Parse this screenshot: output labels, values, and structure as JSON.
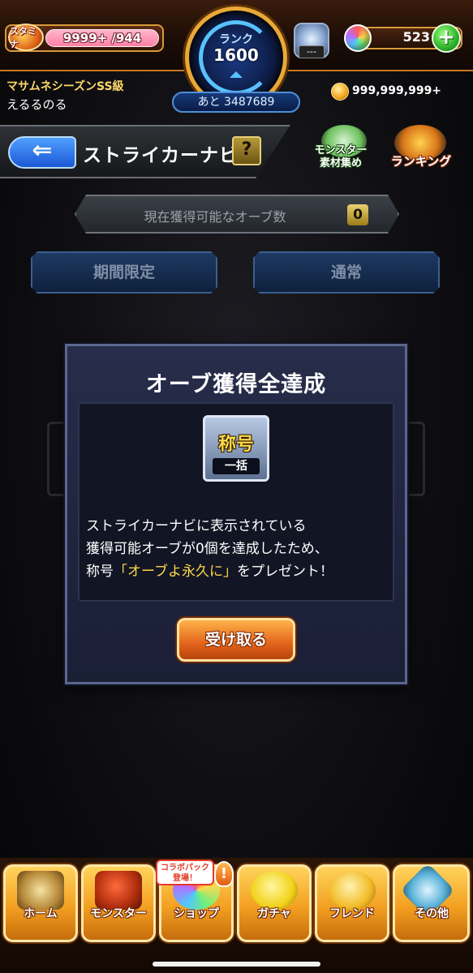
{
  "hud": {
    "stamina_label": "スタミナ",
    "stamina_value": "9999+ /944",
    "rank_label": "ランク",
    "rank_value": "1600",
    "rank_next": "あと 3487689",
    "crystal_placeholder": "---",
    "orb_count": "523",
    "orb_plus": "+",
    "player_title": "マサムネシーズンSS級",
    "player_name": "えるるのる",
    "gold": "999,999,999+"
  },
  "header": {
    "back_icon": "⇐",
    "title": "ストライカーナビ",
    "help_label": "?",
    "material_label_1": "モンスター",
    "material_label_2": "素材集め",
    "ranking_label": "ランキング"
  },
  "orb_status": {
    "label": "現在獲得可能なオーブ数",
    "value": "0"
  },
  "tabs": [
    {
      "label": "期間限定"
    },
    {
      "label": "通常"
    }
  ],
  "modal": {
    "title": "オーブ獲得全達成",
    "icon_main": "称号",
    "icon_sub": "一括",
    "line1": "ストライカーナビに表示されている",
    "line2": "獲得可能オーブが0個を達成したため、",
    "line3_pre": "称号",
    "line3_highlight": "「オーブよ永久に」",
    "line3_post": "をプレゼント！",
    "button": "受け取る"
  },
  "bottom_nav": {
    "items": [
      {
        "label": "ホーム",
        "icon": "home-icon"
      },
      {
        "label": "モンスター",
        "icon": "monster-icon"
      },
      {
        "label": "ショップ",
        "icon": "shop-icon"
      },
      {
        "label": "ガチャ",
        "icon": "gacha-icon"
      },
      {
        "label": "フレンド",
        "icon": "friend-icon"
      },
      {
        "label": "その他",
        "icon": "other-icon"
      }
    ],
    "collab_badge_1": "コラボパック",
    "collab_badge_2": "登場！",
    "alert": "!"
  },
  "colors": {
    "accent_orange": "#f3a021",
    "highlight_yellow": "#ffd84a",
    "modal_bg": "#272d4a",
    "tab_blue": "#1e3a63"
  }
}
